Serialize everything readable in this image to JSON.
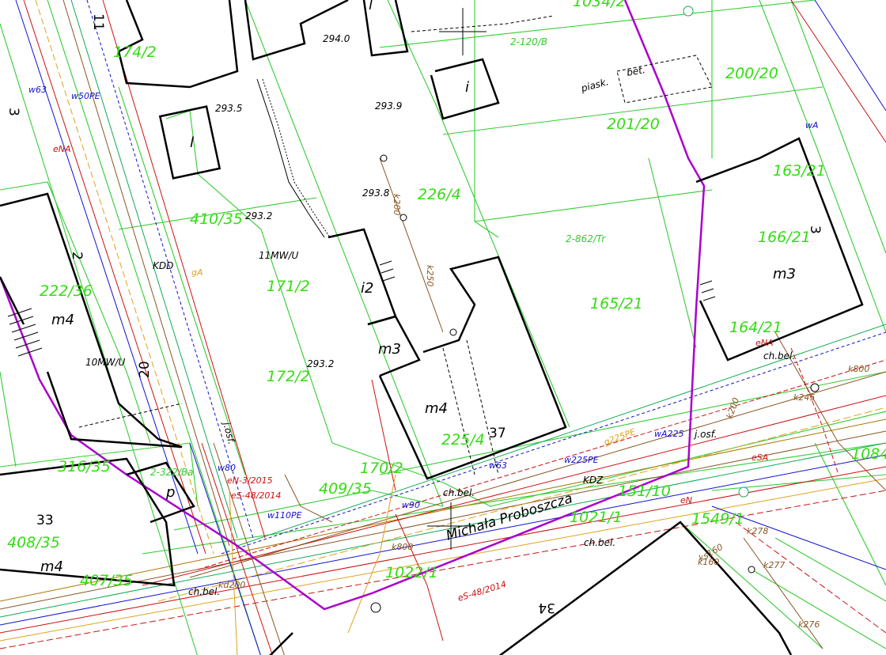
{
  "colors": {
    "parcel_line": "#33cc33",
    "parcel_label": "#33dd11",
    "building": "#000000",
    "road_boundary": "#aa00cc",
    "water": "#1111cc",
    "gas": "#e0a020",
    "power": "#cc1111",
    "sewer": "#885522",
    "telecom": "#11aa55",
    "heat": "#aa7700"
  },
  "parcels": [
    {
      "label": "174/2"
    },
    {
      "label": "410/35"
    },
    {
      "label": "171/2"
    },
    {
      "label": "172/2"
    },
    {
      "label": "226/4"
    },
    {
      "label": "201/20"
    },
    {
      "label": "200/20"
    },
    {
      "label": "163/21"
    },
    {
      "label": "166/21"
    },
    {
      "label": "165/21"
    },
    {
      "label": "164/21"
    },
    {
      "label": "222/36"
    },
    {
      "label": "316/35"
    },
    {
      "label": "408/35"
    },
    {
      "label": "407/35"
    },
    {
      "label": "409/35"
    },
    {
      "label": "170/2"
    },
    {
      "label": "225/4"
    },
    {
      "label": "151/10"
    },
    {
      "label": "1021/1"
    },
    {
      "label": "1022/1"
    },
    {
      "label": "1549/1"
    },
    {
      "label": "1084"
    },
    {
      "label": "1034/2"
    }
  ],
  "buildings": [
    {
      "label": "m4"
    },
    {
      "label": "m4"
    },
    {
      "label": "m4"
    },
    {
      "label": "m3"
    },
    {
      "label": "m3"
    },
    {
      "label": "i2"
    },
    {
      "label": "i"
    },
    {
      "label": "l"
    },
    {
      "label": "l"
    },
    {
      "label": "p"
    }
  ],
  "house_numbers": [
    "11",
    "3",
    "2",
    "20",
    "37",
    "33",
    "34",
    "3"
  ],
  "street_name": "Michała Proboszcza",
  "elevations": [
    "294.0",
    "293.9",
    "293.5",
    "293.8",
    "293.2",
    "293.2"
  ],
  "annotations": [
    "11MW/U",
    "10MW/U",
    "KDD",
    "KDZ",
    "2-120/B",
    "2-862/Tr",
    "2-322/Ba",
    "ch.bel.",
    "ch.bel.",
    "ch.bel.",
    "ch.bel.",
    "piask.",
    "bet.",
    "j.osf.",
    "j.osf."
  ],
  "utility_labels": [
    "w63",
    "w50PE",
    "w90",
    "w110PE",
    "w225PE",
    "wA225",
    "w80",
    "w63",
    "wA",
    "gA",
    "eNA",
    "eN-3/2015",
    "eS-48/2014",
    "eS-48/2014",
    "k800",
    "k800",
    "k245",
    "k200",
    "k278",
    "k277",
    "k276",
    "k160",
    "k200",
    "k250",
    "kd200",
    "ks160",
    "g225PE",
    "eSA",
    "eNA",
    "eN"
  ]
}
